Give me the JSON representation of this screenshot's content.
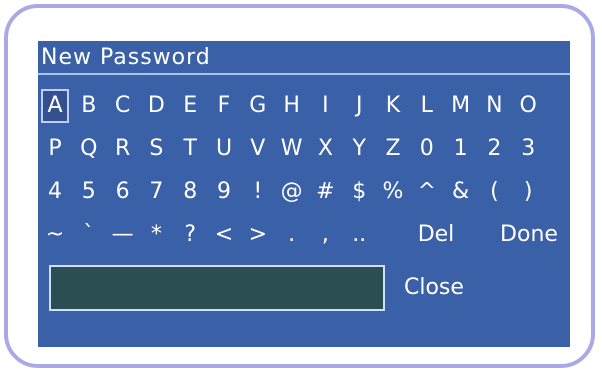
{
  "dialog": {
    "title": "New Password",
    "rows": [
      [
        "A",
        "B",
        "C",
        "D",
        "E",
        "F",
        "G",
        "H",
        "I",
        "J",
        "K",
        "L",
        "M",
        "N",
        "O"
      ],
      [
        "P",
        "Q",
        "R",
        "S",
        "T",
        "U",
        "V",
        "W",
        "X",
        "Y",
        "Z",
        "0",
        "1",
        "2",
        "3"
      ],
      [
        "4",
        "5",
        "6",
        "7",
        "8",
        "9",
        "!",
        "@",
        "#",
        "$",
        "%",
        "^",
        "&",
        "(",
        ")"
      ],
      [
        "~",
        "`",
        "—",
        "*",
        "?",
        "<",
        ">",
        ".",
        ",",
        ".."
      ]
    ],
    "del_label": "Del",
    "done_label": "Done",
    "close_label": "Close",
    "password_value": "",
    "selected_key": "A"
  },
  "colors": {
    "frame": "#a9a9e6",
    "panel": "#3a60a8",
    "input": "#2a4e52"
  }
}
